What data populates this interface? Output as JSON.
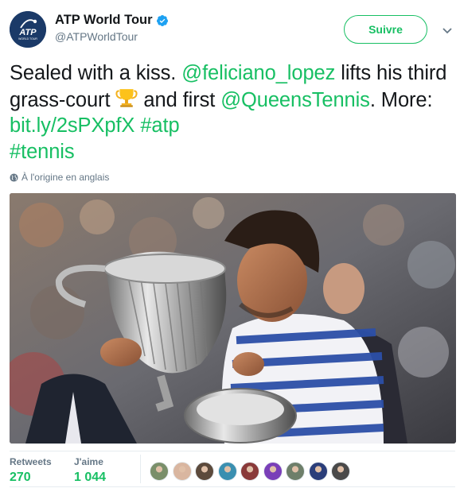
{
  "account": {
    "display_name": "ATP World Tour",
    "handle": "@ATPWorldTour",
    "avatar_icon": "atp-logo-icon",
    "verified_icon": "verified-badge-icon",
    "avatar_text": "ATP",
    "avatar_subtext": "WORLD TOUR"
  },
  "follow_button": {
    "label": "Suivre"
  },
  "menu": {
    "icon": "chevron-down-icon"
  },
  "tweet": {
    "part1": "Sealed with a kiss. ",
    "mention1": "@feliciano_lopez",
    "part2": " lifts his third grass-court ",
    "trophy_icon": "trophy-emoji-icon",
    "part3": " and first ",
    "mention2": "@QueensTennis",
    "part4": ". More: ",
    "link": "bit.ly/2sPXpfX",
    "space1": " ",
    "hashtag1": "#atp",
    "space2": " ",
    "hashtag2": "#tennis"
  },
  "translation": {
    "icon": "globe-icon",
    "label": "À l'origine en anglais"
  },
  "photo": {
    "icon": "player-kissing-trophy-photo"
  },
  "stats": {
    "retweets_label": "Retweets",
    "retweets_value": "270",
    "likes_label": "J'aime",
    "likes_value": "1 044"
  },
  "likers": [
    {
      "icon": "liker-avatar-icon",
      "color": "#7a8f6a"
    },
    {
      "icon": "liker-avatar-icon",
      "color": "#d9b6a0"
    },
    {
      "icon": "liker-avatar-icon",
      "color": "#5c4a3c"
    },
    {
      "icon": "liker-avatar-icon",
      "color": "#3a8fb0"
    },
    {
      "icon": "liker-avatar-icon",
      "color": "#8a3a3a"
    },
    {
      "icon": "liker-avatar-icon",
      "color": "#7a3fb8"
    },
    {
      "icon": "liker-avatar-icon",
      "color": "#6e7f6a"
    },
    {
      "icon": "liker-avatar-icon",
      "color": "#2b3e7a"
    },
    {
      "icon": "liker-avatar-icon",
      "color": "#4a4a4a"
    }
  ],
  "colors": {
    "accent": "#17bf63",
    "verified": "#1da1f2",
    "text": "#14171a",
    "secondary": "#657786"
  }
}
